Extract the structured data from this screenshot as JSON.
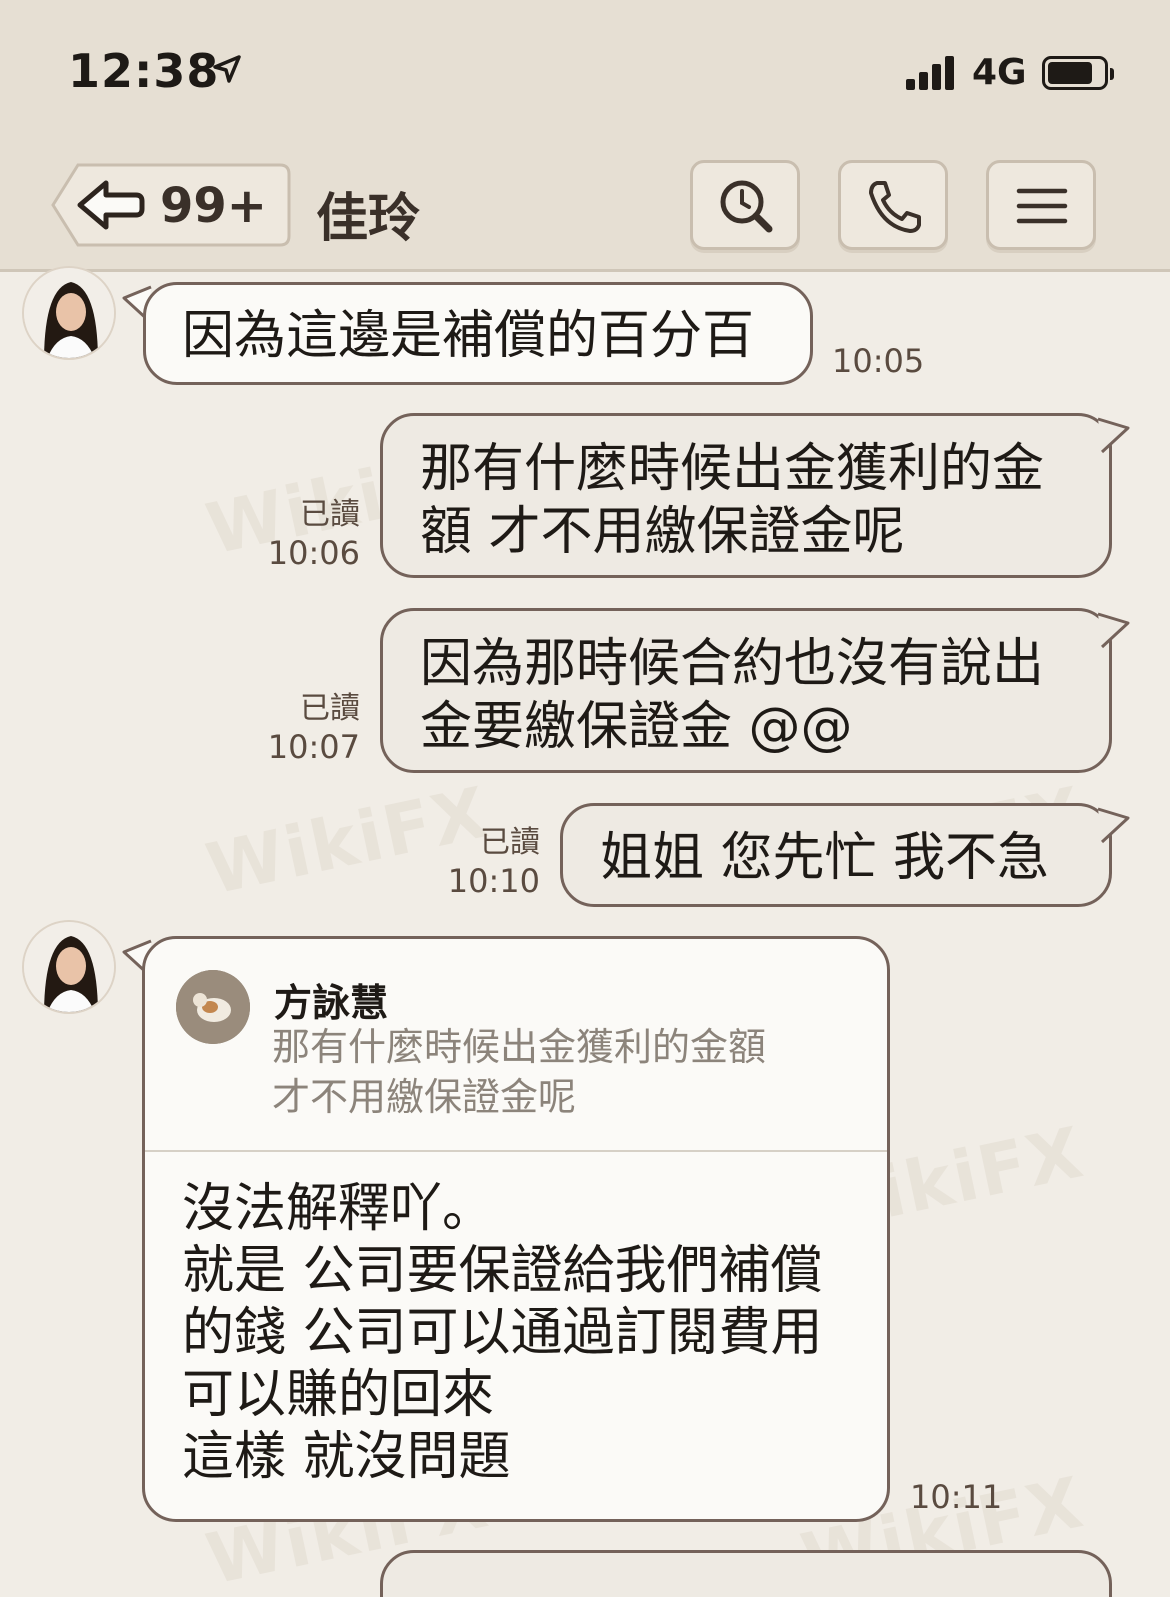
{
  "status_bar": {
    "time": "12:38",
    "network": "4G"
  },
  "header": {
    "unread_count": "99+",
    "contact_name": "佳玲"
  },
  "messages": [
    {
      "lines": [
        "因為這邊是補償的百分百"
      ],
      "time": "10:05"
    },
    {
      "lines": [
        "那有什麼時候出金獲利的金",
        "額 才不用繳保證金呢"
      ],
      "read": "已讀",
      "time": "10:06"
    },
    {
      "lines": [
        "因為那時候合約也沒有說出",
        "金要繳保證金 @@"
      ],
      "read": "已讀",
      "time": "10:07"
    },
    {
      "lines": [
        "姐姐 您先忙  我不急"
      ],
      "read": "已讀",
      "time": "10:10"
    },
    {
      "quote": {
        "author": "方詠慧",
        "lines": [
          "那有什麼時候出金獲利的金額",
          "才不用繳保證金呢"
        ]
      },
      "lines": [
        "沒法解釋吖。",
        "就是 公司要保證給我們補償",
        "的錢  公司可以通過訂閱費用",
        "可以賺的回來",
        "這樣 就沒問題"
      ],
      "time": "10:11"
    }
  ],
  "watermark": "WikiFX"
}
